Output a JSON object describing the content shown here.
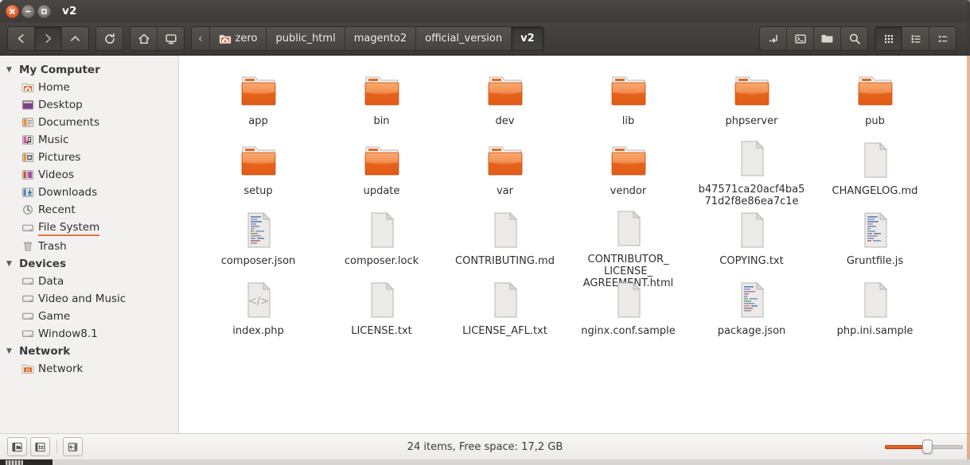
{
  "window": {
    "title": "v2",
    "controls": [
      "close",
      "minimize",
      "maximize"
    ]
  },
  "toolbar": {
    "nav": [
      {
        "name": "back-button",
        "icon": "chevron-left-icon",
        "label": "Back",
        "state": "normal"
      },
      {
        "name": "forward-button",
        "icon": "chevron-right-icon",
        "label": "Forward",
        "state": "pressed"
      },
      {
        "name": "up-button",
        "icon": "chevron-up-icon",
        "label": "Up",
        "state": "normal"
      }
    ],
    "reload": {
      "name": "reload-button",
      "icon": "reload-icon",
      "label": "Reload"
    },
    "places": [
      {
        "name": "home-button",
        "icon": "home-icon",
        "label": "Home"
      },
      {
        "name": "computer-button",
        "icon": "monitor-icon",
        "label": "Computer"
      }
    ],
    "actions": [
      {
        "name": "open-terminal-here-button",
        "icon": "enter-arrow-icon",
        "label": "Open Terminal Here"
      },
      {
        "name": "terminal-button",
        "icon": "terminal-icon",
        "label": "Terminal"
      },
      {
        "name": "new-folder-button",
        "icon": "folder-icon",
        "label": "New Folder"
      },
      {
        "name": "search-button",
        "icon": "search-icon",
        "label": "Search"
      }
    ],
    "views": [
      {
        "name": "icon-view-button",
        "icon": "grid-view-icon",
        "label": "Icon View",
        "active": true
      },
      {
        "name": "list-view-button",
        "icon": "list-view-icon",
        "label": "List View",
        "active": false
      },
      {
        "name": "compact-view-button",
        "icon": "compact-view-icon",
        "label": "Compact View",
        "active": false
      }
    ]
  },
  "breadcrumb": {
    "prev_label": "‹",
    "items": [
      {
        "label": "zero",
        "icon": "home-folder-icon",
        "active": false
      },
      {
        "label": "public_html",
        "icon": "",
        "active": false
      },
      {
        "label": "magento2",
        "icon": "",
        "active": false
      },
      {
        "label": "official_version",
        "icon": "",
        "active": false
      },
      {
        "label": "v2",
        "icon": "",
        "active": true
      }
    ]
  },
  "sidebar": {
    "groups": [
      {
        "title": "My Computer",
        "expanded": true,
        "items": [
          {
            "label": "Home",
            "icon": "home-folder-icon",
            "hovered": false
          },
          {
            "label": "Desktop",
            "icon": "desktop-icon",
            "hovered": false
          },
          {
            "label": "Documents",
            "icon": "documents-icon",
            "hovered": false
          },
          {
            "label": "Music",
            "icon": "music-icon",
            "hovered": false
          },
          {
            "label": "Pictures",
            "icon": "pictures-icon",
            "hovered": false
          },
          {
            "label": "Videos",
            "icon": "videos-icon",
            "hovered": false
          },
          {
            "label": "Downloads",
            "icon": "downloads-icon",
            "hovered": false
          },
          {
            "label": "Recent",
            "icon": "recent-icon",
            "hovered": false
          },
          {
            "label": "File System",
            "icon": "drive-icon",
            "hovered": true
          },
          {
            "label": "Trash",
            "icon": "trash-icon",
            "hovered": false
          }
        ]
      },
      {
        "title": "Devices",
        "expanded": true,
        "items": [
          {
            "label": "Data",
            "icon": "drive-icon",
            "hovered": false
          },
          {
            "label": "Video and Music",
            "icon": "drive-icon",
            "hovered": false
          },
          {
            "label": "Game",
            "icon": "drive-icon",
            "hovered": false
          },
          {
            "label": "Window8.1",
            "icon": "drive-icon",
            "hovered": false
          }
        ]
      },
      {
        "title": "Network",
        "expanded": true,
        "items": [
          {
            "label": "Network",
            "icon": "network-folder-icon",
            "hovered": false
          }
        ]
      }
    ]
  },
  "files": [
    {
      "name": "app",
      "type": "folder",
      "icon": "folder-icon"
    },
    {
      "name": "bin",
      "type": "folder",
      "icon": "folder-icon"
    },
    {
      "name": "dev",
      "type": "folder",
      "icon": "folder-icon"
    },
    {
      "name": "lib",
      "type": "folder",
      "icon": "folder-icon"
    },
    {
      "name": "phpserver",
      "type": "folder",
      "icon": "folder-icon"
    },
    {
      "name": "pub",
      "type": "folder",
      "icon": "folder-icon"
    },
    {
      "name": "setup",
      "type": "folder",
      "icon": "folder-icon"
    },
    {
      "name": "update",
      "type": "folder",
      "icon": "folder-icon"
    },
    {
      "name": "var",
      "type": "folder",
      "icon": "folder-icon"
    },
    {
      "name": "vendor",
      "type": "folder",
      "icon": "folder-icon"
    },
    {
      "name": "b47571ca20acf4ba5\n71d2f8e86ea7c1e",
      "type": "file",
      "icon": "blank-document-icon"
    },
    {
      "name": "CHANGELOG.md",
      "type": "file",
      "icon": "blank-document-icon"
    },
    {
      "name": "composer.json",
      "type": "file",
      "icon": "code-document-icon"
    },
    {
      "name": "composer.lock",
      "type": "file",
      "icon": "blank-document-icon"
    },
    {
      "name": "CONTRIBUTING.md",
      "type": "file",
      "icon": "blank-document-icon"
    },
    {
      "name": "CONTRIBUTOR_\nLICENSE_\nAGREEMENT.html",
      "type": "file",
      "icon": "blank-document-icon"
    },
    {
      "name": "COPYING.txt",
      "type": "file",
      "icon": "blank-document-icon"
    },
    {
      "name": "Gruntfile.js",
      "type": "file",
      "icon": "code-document-icon"
    },
    {
      "name": "index.php",
      "type": "file",
      "icon": "php-code-icon"
    },
    {
      "name": "LICENSE.txt",
      "type": "file",
      "icon": "blank-document-icon"
    },
    {
      "name": "LICENSE_AFL.txt",
      "type": "file",
      "icon": "blank-document-icon"
    },
    {
      "name": "nginx.conf.sample",
      "type": "file",
      "icon": "blank-document-icon"
    },
    {
      "name": "package.json",
      "type": "file",
      "icon": "code-document-icon"
    },
    {
      "name": "php.ini.sample",
      "type": "file",
      "icon": "blank-document-icon"
    }
  ],
  "statusbar": {
    "buttons": [
      {
        "name": "places-sidebar-button",
        "icon": "folder-pane-icon",
        "label": "Places"
      },
      {
        "name": "tree-sidebar-button",
        "icon": "tree-pane-icon",
        "label": "Tree"
      },
      {
        "name": "toggle-sidebar-button",
        "icon": "sidebar-toggle-icon",
        "label": "Show Sidebar"
      }
    ],
    "text": "24 items, Free space: 17,2 GB",
    "zoom": {
      "name": "zoom-slider",
      "value": 55,
      "min": 0,
      "max": 100
    }
  },
  "colors": {
    "accent": "#e8733c",
    "folder": "#e8671f",
    "titlebar": "#3d3a38",
    "sidebar_bg": "#f2f1f0"
  }
}
